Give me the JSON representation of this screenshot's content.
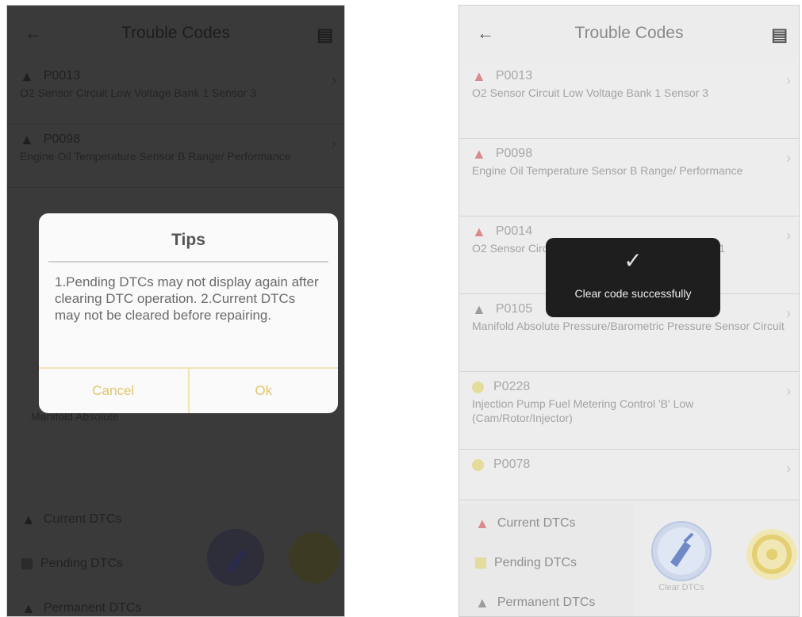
{
  "left": {
    "header": {
      "title": "Trouble Codes",
      "back_icon": "arrow-left-icon",
      "menu_icon": "report-icon"
    },
    "codes": [
      {
        "code": "P0013",
        "desc": "O2 Sensor Circuit Low Voltage Bank 1 Sensor 3",
        "type": "current"
      },
      {
        "code": "P0098",
        "desc": "Engine Oil Temperature Sensor B Range/ Performance",
        "type": "current"
      }
    ],
    "bg_label": "Manifold Absolute",
    "legend": {
      "current": "Current DTCs",
      "pending": "Pending DTCs",
      "permanent": "Permanent DTCs"
    },
    "dialog": {
      "title": "Tips",
      "body": "1.Pending DTCs may not display again after clearing DTC operation. 2.Current DTCs may not be cleared before repairing.",
      "cancel": "Cancel",
      "ok": "Ok"
    }
  },
  "right": {
    "header": {
      "title": "Trouble Codes",
      "back_icon": "arrow-left-icon",
      "menu_icon": "report-icon"
    },
    "codes": [
      {
        "code": "P0013",
        "desc": "O2 Sensor Circuit Low Voltage Bank 1 Sensor 3",
        "type": "current"
      },
      {
        "code": "P0098",
        "desc": "Engine Oil Temperature Sensor B Range/ Performance",
        "type": "current"
      },
      {
        "code": "P0014",
        "desc": "O2 Sensor Circuit Slow Response Bank 1 Sensor 1",
        "type": "current"
      },
      {
        "code": "P0105",
        "desc": "Manifold Absolute Pressure/Barometric Pressure Sensor Circuit",
        "type": "permanent"
      },
      {
        "code": "P0228",
        "desc": "Injection Pump Fuel Metering Control 'B' Low (Cam/Rotor/Injector)",
        "type": "pending"
      },
      {
        "code": "P0078",
        "desc": "",
        "type": "pending"
      }
    ],
    "legend": {
      "current": "Current DTCs",
      "pending": "Pending DTCs",
      "permanent": "Permanent DTCs"
    },
    "clear_label": "Clear DTCs",
    "toast": {
      "message": "Clear code successfully"
    }
  },
  "colors": {
    "accent": "#e0c66a",
    "current": "#d98a8a",
    "pending": "#e4dc9a",
    "permanent": "#9c9c9c"
  }
}
